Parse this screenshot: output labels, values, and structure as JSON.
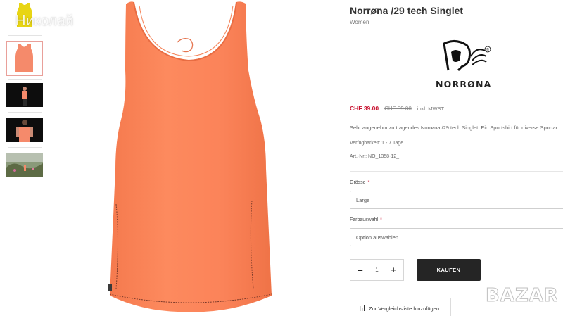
{
  "watermark": {
    "user_name": "Николай"
  },
  "gallery": {
    "thumbnails": [
      {
        "label": "thumbnail-yellow-singlet",
        "color": "#e8d514",
        "active": false
      },
      {
        "label": "thumbnail-orange-singlet",
        "color": "#f58a6b",
        "active": true
      },
      {
        "label": "thumbnail-model-front",
        "color": "#111111",
        "active": false
      },
      {
        "label": "thumbnail-model-back",
        "color": "#111111",
        "active": false
      },
      {
        "label": "thumbnail-outdoor",
        "color": "#6c7a55",
        "active": false
      }
    ],
    "main_image_color": "#fb8359",
    "seam_color": "#7a3a2a"
  },
  "product": {
    "title": "Norrøna /29 tech Singlet",
    "category": "Women",
    "brand_name": "NORRØNA",
    "brand_registered": "®",
    "price_current": "CHF 39.00",
    "price_old": "CHF 59.00",
    "tax_note": "inkl. MWST",
    "description": "Sehr angenehm zu tragendes Norrøna /29 tech Singlet. Ein Sportshirt für diverse Sportar",
    "availability": "Verfügbarkeit:  1 - 7 Tage",
    "sku": "Art.-Nr.:  NO_1358-12_"
  },
  "options": {
    "size_label": "Grösse",
    "size_value": "Large",
    "color_label": "Farbauswahl",
    "color_placeholder": "Option auswählen...",
    "required_mark": "*"
  },
  "cart": {
    "minus": "–",
    "quantity": "1",
    "plus": "+",
    "buy_label": "KAUFEN"
  },
  "compare": {
    "label": "Zur Vergleichsliste hinzufügen"
  },
  "site_watermark": "BAZAR",
  "colors": {
    "price_red": "#c8102e",
    "buy_button": "#252525",
    "product_orange": "#fb8359"
  }
}
